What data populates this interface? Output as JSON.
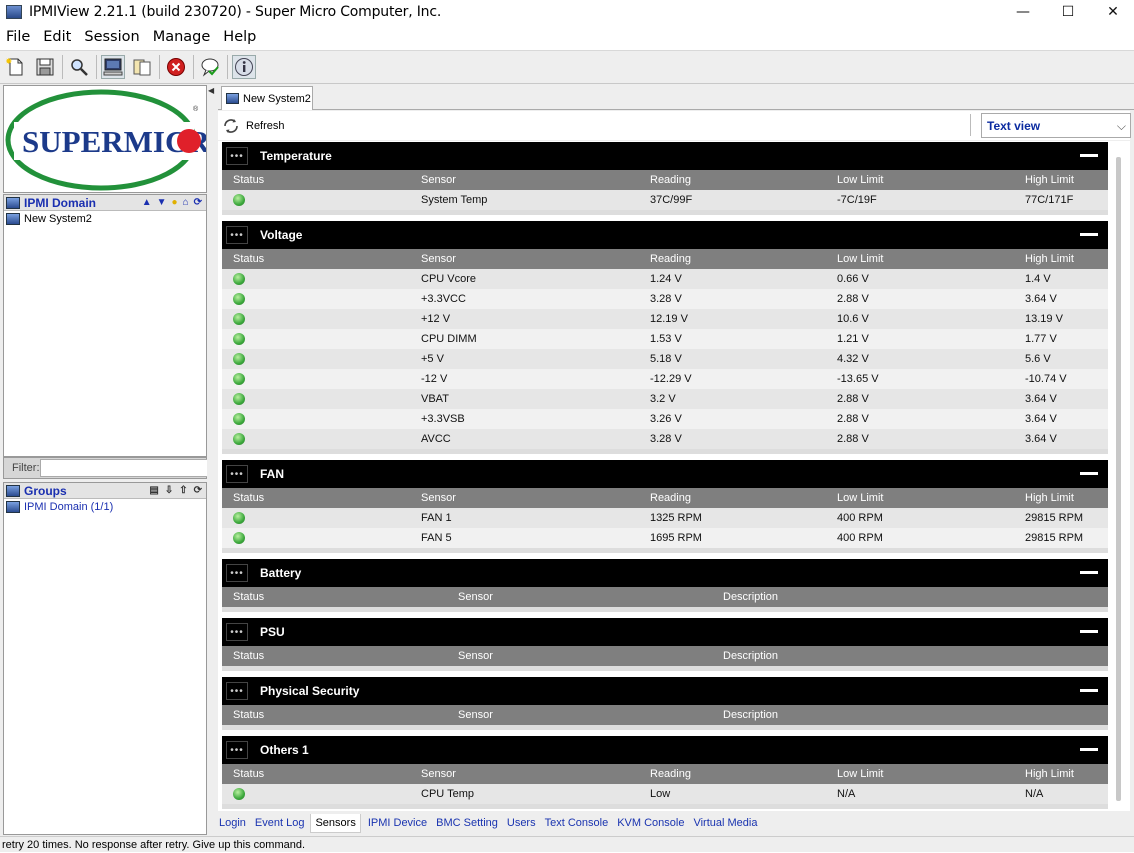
{
  "window": {
    "title": "IPMIView 2.21.1 (build 230720) - Super Micro Computer, Inc.",
    "minimize": "—",
    "maximize": "☐",
    "close": "✕"
  },
  "menu": [
    "File",
    "Edit",
    "Session",
    "Manage",
    "Help"
  ],
  "toolbar": {
    "icons": [
      "new-file-icon",
      "save-icon",
      "search-icon",
      "monitor-icon",
      "copy-icon",
      "stop-icon",
      "chat-check-icon",
      "info-icon"
    ]
  },
  "left": {
    "logo_text": "SUPERMICR",
    "domain_header": "IPMI Domain",
    "domain_items": [
      "New System2"
    ],
    "filter_label": "Filter:",
    "filter_value": "",
    "groups_header": "Groups",
    "group_items": [
      "IPMI Domain (1/1)"
    ]
  },
  "tab": {
    "label": "New System2"
  },
  "toolbar2": {
    "refresh_label": "Refresh",
    "view_select": "Text view"
  },
  "columns": {
    "status": "Status",
    "sensor": "Sensor",
    "reading": "Reading",
    "low": "Low Limit",
    "high": "High Limit",
    "description": "Description"
  },
  "sections": [
    {
      "title": "Temperature",
      "rows": [
        {
          "sensor": "System Temp",
          "reading": "37C/99F",
          "low": "-7C/19F",
          "high": "77C/171F"
        }
      ]
    },
    {
      "title": "Voltage",
      "rows": [
        {
          "sensor": "CPU Vcore",
          "reading": "1.24 V",
          "low": "0.66 V",
          "high": "1.4 V"
        },
        {
          "sensor": "+3.3VCC",
          "reading": "3.28 V",
          "low": "2.88 V",
          "high": "3.64 V"
        },
        {
          "sensor": "+12 V",
          "reading": "12.19 V",
          "low": "10.6 V",
          "high": "13.19 V"
        },
        {
          "sensor": "CPU DIMM",
          "reading": "1.53 V",
          "low": "1.21 V",
          "high": "1.77 V"
        },
        {
          "sensor": "+5 V",
          "reading": "5.18 V",
          "low": "4.32 V",
          "high": "5.6 V"
        },
        {
          "sensor": "-12 V",
          "reading": "-12.29 V",
          "low": "-13.65 V",
          "high": "-10.74 V"
        },
        {
          "sensor": "VBAT",
          "reading": "3.2 V",
          "low": "2.88 V",
          "high": "3.64 V"
        },
        {
          "sensor": "+3.3VSB",
          "reading": "3.26 V",
          "low": "2.88 V",
          "high": "3.64 V"
        },
        {
          "sensor": "AVCC",
          "reading": "3.28 V",
          "low": "2.88 V",
          "high": "3.64 V"
        }
      ]
    },
    {
      "title": "FAN",
      "rows": [
        {
          "sensor": "FAN 1",
          "reading": "1325 RPM",
          "low": "400 RPM",
          "high": "29815 RPM"
        },
        {
          "sensor": "FAN 5",
          "reading": "1695 RPM",
          "low": "400 RPM",
          "high": "29815 RPM"
        }
      ]
    },
    {
      "title": "Battery",
      "rows": []
    },
    {
      "title": "PSU",
      "rows": []
    },
    {
      "title": "Physical Security",
      "rows": []
    },
    {
      "title": "Others 1",
      "rows": [
        {
          "sensor": "CPU Temp",
          "reading": "Low",
          "low": "N/A",
          "high": "N/A"
        }
      ]
    }
  ],
  "bottom_tabs": [
    "Login",
    "Event Log",
    "Sensors",
    "IPMI Device",
    "BMC Setting",
    "Users",
    "Text Console",
    "KVM Console",
    "Virtual Media"
  ],
  "active_bottom_tab": "Sensors",
  "status": "retry 20 times. No response after retry. Give up this command."
}
